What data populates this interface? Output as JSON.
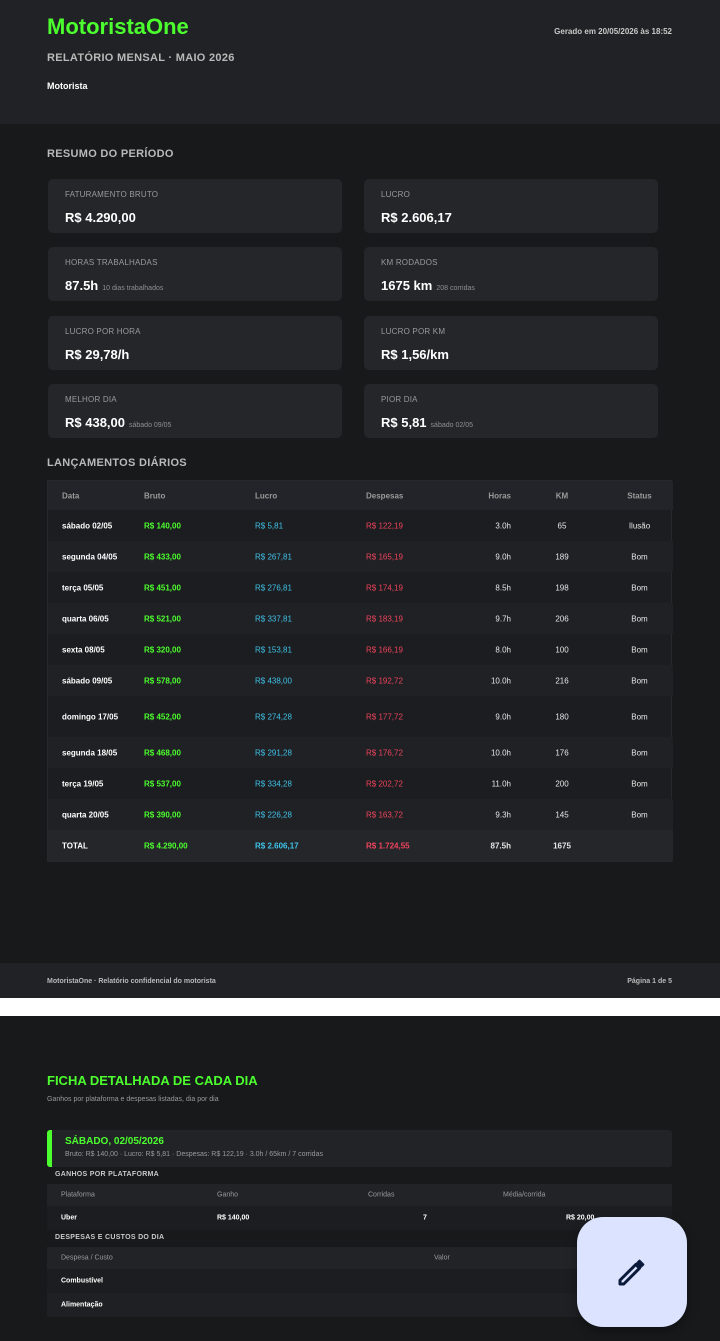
{
  "header": {
    "logo": "MotoristaOne",
    "generated": "Gerado em 20/05/2026 às 18:52",
    "report_title": "RELATÓRIO MENSAL · MAIO 2026",
    "driver_label": "Motorista"
  },
  "summary": {
    "title": "RESUMO DO PERÍODO",
    "cards": [
      {
        "label": "FATURAMENTO BRUTO",
        "value": "R$ 4.290,00",
        "sub": ""
      },
      {
        "label": "LUCRO",
        "value": "R$ 2.606,17",
        "sub": ""
      },
      {
        "label": "HORAS TRABALHADAS",
        "value": "87.5h",
        "sub": "10 dias trabalhados"
      },
      {
        "label": "KM RODADOS",
        "value": "1675 km",
        "sub": "208 corridas"
      },
      {
        "label": "LUCRO POR HORA",
        "value": "R$ 29,78/h",
        "sub": ""
      },
      {
        "label": "LUCRO POR KM",
        "value": "R$ 1,56/km",
        "sub": ""
      },
      {
        "label": "MELHOR DIA",
        "value": "R$ 438,00",
        "sub": "sábado 09/05"
      },
      {
        "label": "PIOR DIA",
        "value": "R$ 5,81",
        "sub": "sábado 02/05"
      }
    ]
  },
  "daily": {
    "title": "LANÇAMENTOS DIÁRIOS",
    "columns": [
      "Data",
      "Bruto",
      "Lucro",
      "Despesas",
      "Horas",
      "KM",
      "Status"
    ],
    "rows": [
      {
        "date": "sábado 02/05",
        "bruto": "R$ 140,00",
        "lucro": "R$ 5,81",
        "desp": "R$ 122,19",
        "horas": "3.0h",
        "km": "65",
        "status": "Ilusão"
      },
      {
        "date": "segunda 04/05",
        "bruto": "R$ 433,00",
        "lucro": "R$ 267,81",
        "desp": "R$ 165,19",
        "horas": "9.0h",
        "km": "189",
        "status": "Bom"
      },
      {
        "date": "terça 05/05",
        "bruto": "R$ 451,00",
        "lucro": "R$ 276,81",
        "desp": "R$ 174,19",
        "horas": "8.5h",
        "km": "198",
        "status": "Bom"
      },
      {
        "date": "quarta 06/05",
        "bruto": "R$ 521,00",
        "lucro": "R$ 337,81",
        "desp": "R$ 183,19",
        "horas": "9.7h",
        "km": "206",
        "status": "Bom"
      },
      {
        "date": "sexta 08/05",
        "bruto": "R$ 320,00",
        "lucro": "R$ 153,81",
        "desp": "R$ 166,19",
        "horas": "8.0h",
        "km": "100",
        "status": "Bom"
      },
      {
        "date": "sábado 09/05",
        "bruto": "R$ 578,00",
        "lucro": "R$ 438,00",
        "desp": "R$ 192,72",
        "horas": "10.0h",
        "km": "216",
        "status": "Bom"
      },
      {
        "date": "domingo 17/05",
        "bruto": "R$ 452,00",
        "lucro": "R$ 274,28",
        "desp": "R$ 177,72",
        "horas": "9.0h",
        "km": "180",
        "status": "Bom"
      },
      {
        "date": "segunda 18/05",
        "bruto": "R$ 468,00",
        "lucro": "R$ 291,28",
        "desp": "R$ 176,72",
        "horas": "10.0h",
        "km": "176",
        "status": "Bom"
      },
      {
        "date": "terça 19/05",
        "bruto": "R$ 537,00",
        "lucro": "R$ 334,28",
        "desp": "R$ 202,72",
        "horas": "11.0h",
        "km": "200",
        "status": "Bom"
      },
      {
        "date": "quarta 20/05",
        "bruto": "R$ 390,00",
        "lucro": "R$ 226,28",
        "desp": "R$ 163,72",
        "horas": "9.3h",
        "km": "145",
        "status": "Bom"
      }
    ],
    "total": {
      "date": "TOTAL",
      "bruto": "R$ 4.290,00",
      "lucro": "R$ 2.606,17",
      "desp": "R$ 1.724,55",
      "horas": "87.5h",
      "km": "1675",
      "status": ""
    }
  },
  "footer": {
    "left": "MotoristaOne · Relatório confidencial do motorista",
    "right": "Página 1 de 5"
  },
  "detail": {
    "title": "FICHA DETALHADA DE CADA DIA",
    "subtitle": "Ganhos por plataforma e despesas listadas, dia por dia",
    "day_title": "SÁBADO, 02/05/2026",
    "day_summary": "Bruto: R$ 140,00  ·  Lucro: R$ 5,81  ·  Despesas: R$ 122,19  ·  3.0h / 65km / 7 corridas",
    "platform_label": "GANHOS POR PLATAFORMA",
    "platform_cols": [
      "Plataforma",
      "Ganho",
      "Corridas",
      "Média/corrida"
    ],
    "platform_row": {
      "name": "Uber",
      "gain": "R$ 140,00",
      "rides": "7",
      "avg": "R$ 20,00"
    },
    "expense_label": "DESPESAS E CUSTOS DO DIA",
    "expense_cols": [
      "Despesa / Custo",
      "Valor"
    ],
    "expense_rows": [
      "Combustível",
      "Alimentação"
    ]
  },
  "fab": {
    "icon": "pencil-icon"
  }
}
